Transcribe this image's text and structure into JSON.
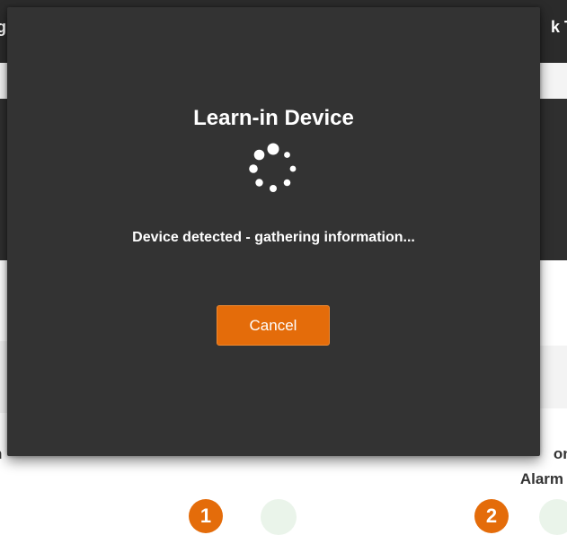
{
  "background": {
    "topbar_left_text": "g",
    "topbar_right_text": "k T",
    "label_right_line1": "ond",
    "label_right_line2": "Alarm",
    "label_left_text": "n",
    "badge_one": "1",
    "badge_two": "2"
  },
  "modal": {
    "title": "Learn-in Device",
    "status": "Device detected - gathering information...",
    "cancel_label": "Cancel",
    "spinner_icon": "loading-spinner-icon"
  },
  "colors": {
    "modal_bg": "#333333",
    "accent": "#e46c0a",
    "topbar_bg": "#2b2b2b",
    "text_light": "#ffffff"
  }
}
